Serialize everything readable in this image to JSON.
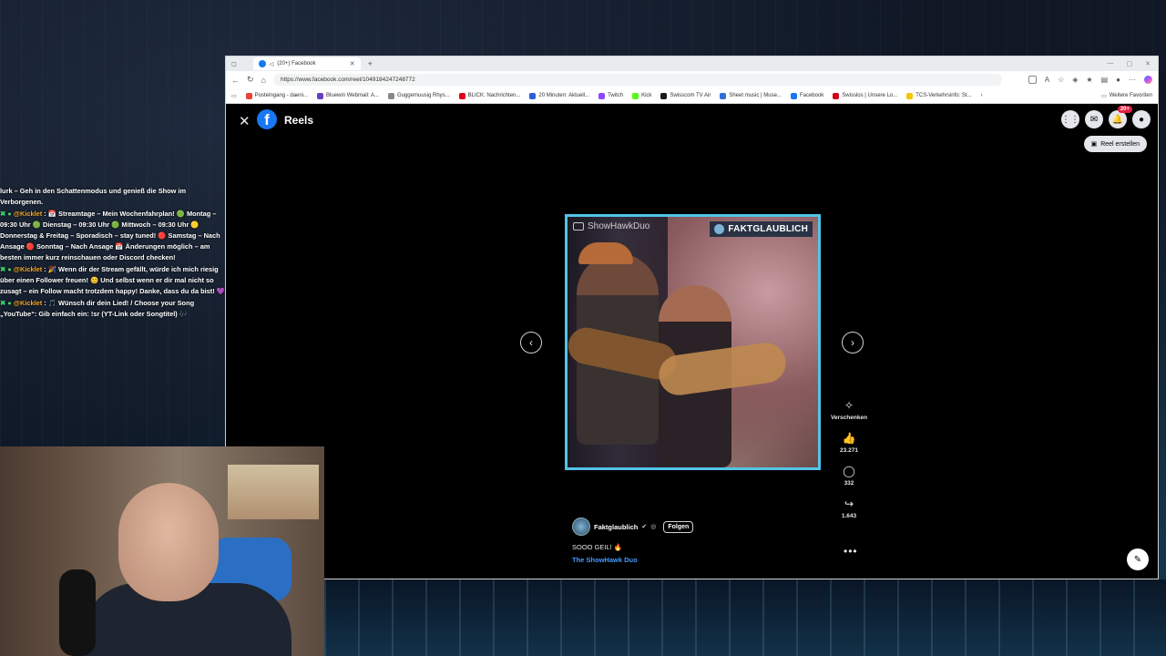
{
  "browser": {
    "tab_title": "(20+) Facebook",
    "url": "https://www.facebook.com/reel/1049184247248772",
    "favorites": [
      {
        "label": "Posteingang - daeni...",
        "color": "#ea4335"
      },
      {
        "label": "Bluewin Webmail: A...",
        "color": "#6a3fbf"
      },
      {
        "label": "Guggemuusig Rhys...",
        "color": "#888888"
      },
      {
        "label": "BLICK: Nachrichten...",
        "color": "#e2001a"
      },
      {
        "label": "20 Minuten: Aktuell...",
        "color": "#2b5fd9"
      },
      {
        "label": "Twitch",
        "color": "#9146ff"
      },
      {
        "label": "Kick",
        "color": "#53fc18"
      },
      {
        "label": "Swisscom TV Air",
        "color": "#1a1a1a"
      },
      {
        "label": "Sheet music | Muse...",
        "color": "#2f6fd6"
      },
      {
        "label": "Facebook",
        "color": "#1877f2"
      },
      {
        "label": "Swisslos | Unsere Lo...",
        "color": "#d0021b"
      },
      {
        "label": "TCS-Verkehrsinfo: St...",
        "color": "#f5c400"
      }
    ],
    "favorites_more": "Weitere Favoriten"
  },
  "page": {
    "title": "Reels",
    "notifications_badge": "20+",
    "create_reel_label": "Reel erstellen"
  },
  "reel": {
    "watermark_left": "ShowHawkDuo",
    "watermark_right": "FAKTGLAUBLICH",
    "author": "Faktglaublich",
    "follow_label": "Folgen",
    "caption": "SOOO GEIL! 🔥",
    "audio": "The ShowHawk Duo",
    "gift_label": "Verschenken",
    "likes": "23.271",
    "comments": "332",
    "shares": "1.643"
  },
  "chat": {
    "line0": "lurk – Geh in den Schattenmodus und genieß die Show im Verborgenen.",
    "messages": [
      {
        "user": "@Kicklet",
        "text": " : 📅 Streamtage – Mein Wochenfahrplan! 🟢 Montag – 09:30 Uhr 🟢 Dienstag – 09:30 Uhr 🟢 Mittwoch – 09:30 Uhr 🟡 Donnerstag & Freitag – Sporadisch – stay tuned! 🔴 Samstag – Nach Ansage 🔴 Sonntag – Nach Ansage 📅 Änderungen möglich – am besten immer kurz reinschauen oder Discord checken!"
      },
      {
        "user": "@Kicklet",
        "text": " : 🎉 Wenn dir der Stream gefällt, würde ich mich riesig über einen Follower freuen! 😊 Und selbst wenn er dir mal nicht so zusagt – ein Follow macht trotzdem happy! Danke, dass du da bist! 💜"
      },
      {
        "user": "@Kicklet",
        "text": " : 🎵 Wünsch dir dein Lied! / Choose your Song „YouTube“: Gib einfach ein: !sr (YT-Link oder Songtitel) 🎶"
      }
    ]
  },
  "colors": {
    "fb_blue": "#1877f2",
    "video_border": "#52c4e8",
    "link_blue": "#4599ff"
  }
}
